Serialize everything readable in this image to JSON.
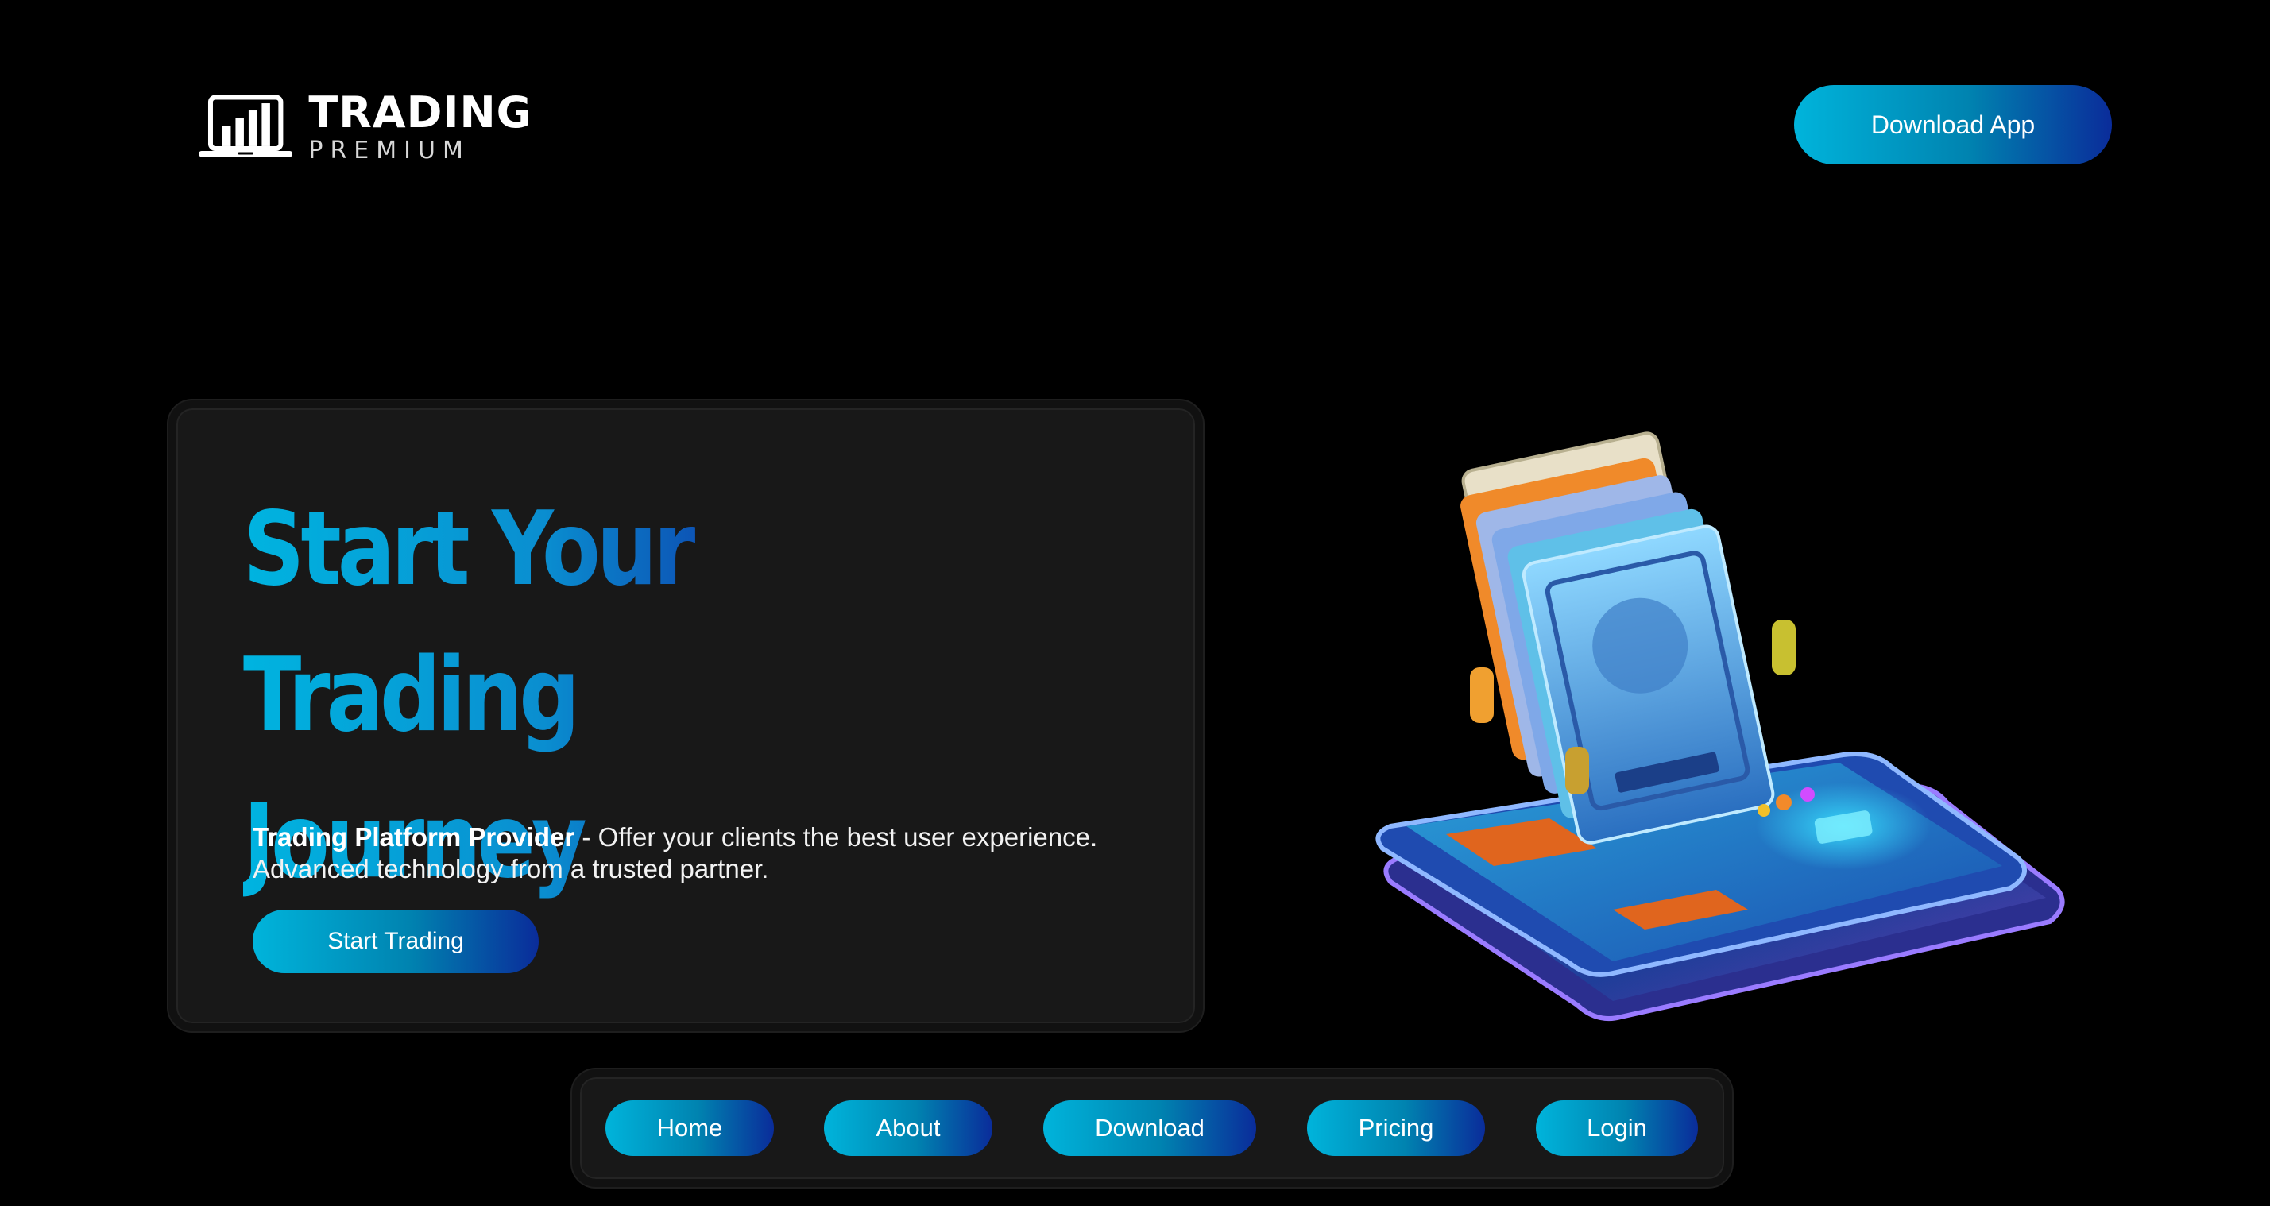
{
  "brand": {
    "name": "TRADING",
    "tagline": "PREMIUM"
  },
  "header": {
    "download_label": "Download App"
  },
  "hero": {
    "title": "Start Your Trading Journey",
    "desc_bold": "Trading Platform Provider",
    "desc_rest": " - Offer your clients the best user experience.",
    "desc_line2": "Advanced technology from a trusted partner.",
    "cta_label": "Start Trading"
  },
  "nav": {
    "items": [
      {
        "label": "Home"
      },
      {
        "label": "About"
      },
      {
        "label": "Download"
      },
      {
        "label": "Pricing"
      },
      {
        "label": "Login"
      }
    ]
  },
  "colors": {
    "background": "#000000",
    "card": "#181818",
    "accent_start": "#00b4db",
    "accent_end": "#0a2c9a"
  },
  "icons": {
    "logo": "laptop-bar-chart-icon",
    "illustration": "phones-and-banknotes-illustration"
  }
}
